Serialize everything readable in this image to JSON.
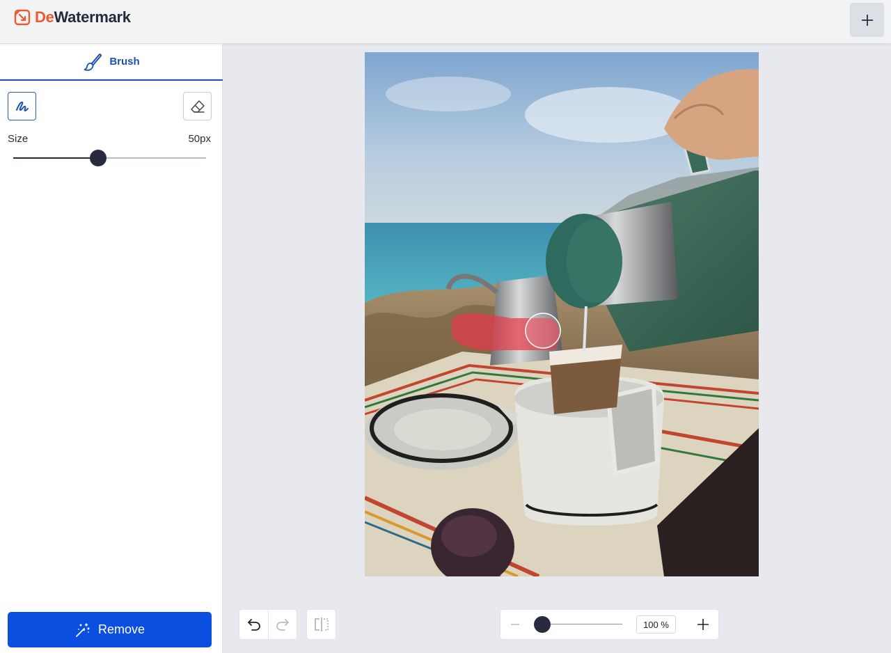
{
  "app": {
    "logo_part1": "De",
    "logo_part2": "Watermark",
    "brand_color": "#ec5a2d",
    "accent_color": "#0b4fe0"
  },
  "header": {
    "add_icon": "plus-icon"
  },
  "sidebar": {
    "tab_label": "Brush",
    "tab_icon": "brush-icon",
    "tools": [
      {
        "name": "brush",
        "icon": "brush-stroke-icon",
        "active": true
      },
      {
        "name": "eraser",
        "icon": "eraser-icon",
        "active": false
      }
    ],
    "size_label": "Size",
    "size_value": "50px",
    "size_slider_fraction": 0.44,
    "remove_label": "Remove",
    "remove_icon": "magic-wand-icon"
  },
  "toolbar": {
    "undo_icon": "undo-icon",
    "redo_icon": "redo-icon",
    "compare_icon": "compare-icon",
    "zoom_minus_icon": "minus-icon",
    "zoom_plus_icon": "plus-icon",
    "zoom_value": "100 %",
    "zoom_slider_fraction": 0.0
  }
}
